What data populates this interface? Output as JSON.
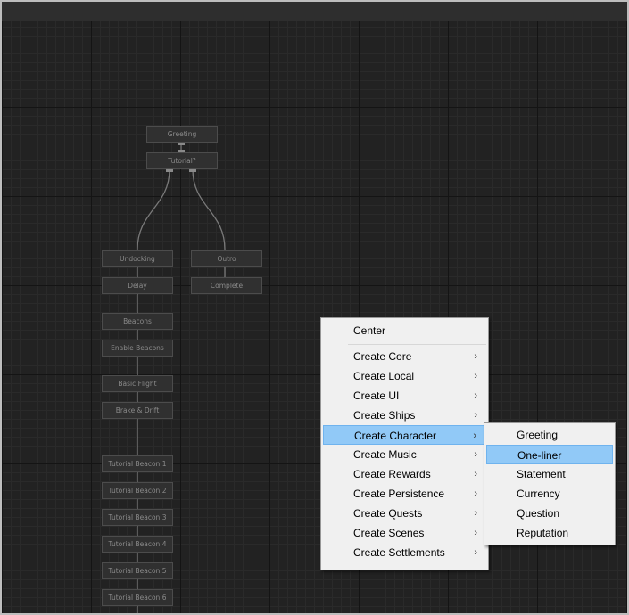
{
  "nodes": {
    "greeting": "Greeting",
    "tutorial": "Tutorial?",
    "undocking": "Undocking",
    "outro": "Outro",
    "delay": "Delay",
    "complete": "Complete",
    "beacons": "Beacons",
    "enable_beacons": "Enable Beacons",
    "basic_flight": "Basic Flight",
    "brake_drift": "Brake & Drift",
    "tutorial_beacon_1": "Tutorial Beacon 1",
    "tutorial_beacon_2": "Tutorial Beacon 2",
    "tutorial_beacon_3": "Tutorial Beacon 3",
    "tutorial_beacon_4": "Tutorial Beacon 4",
    "tutorial_beacon_5": "Tutorial Beacon 5",
    "tutorial_beacon_6": "Tutorial Beacon 6"
  },
  "context_menu": {
    "center": "Center",
    "items": [
      {
        "label": "Create Core"
      },
      {
        "label": "Create Local"
      },
      {
        "label": "Create UI"
      },
      {
        "label": "Create Ships"
      },
      {
        "label": "Create Character"
      },
      {
        "label": "Create Music"
      },
      {
        "label": "Create Rewards"
      },
      {
        "label": "Create Persistence"
      },
      {
        "label": "Create Quests"
      },
      {
        "label": "Create Scenes"
      },
      {
        "label": "Create Settlements"
      }
    ],
    "highlighted": "Create Character",
    "submenu_arrow": "›"
  },
  "submenu": {
    "items": [
      {
        "label": "Greeting"
      },
      {
        "label": "One-liner"
      },
      {
        "label": "Statement"
      },
      {
        "label": "Currency"
      },
      {
        "label": "Question"
      },
      {
        "label": "Reputation"
      }
    ],
    "highlighted": "One-liner"
  },
  "colors": {
    "canvas": "#222222",
    "node_fill": "#303030",
    "node_border": "#4c4c4c",
    "wire": "#7a7a7a",
    "menu_bg": "#f0f0f0",
    "highlight": "#91c9f7"
  }
}
